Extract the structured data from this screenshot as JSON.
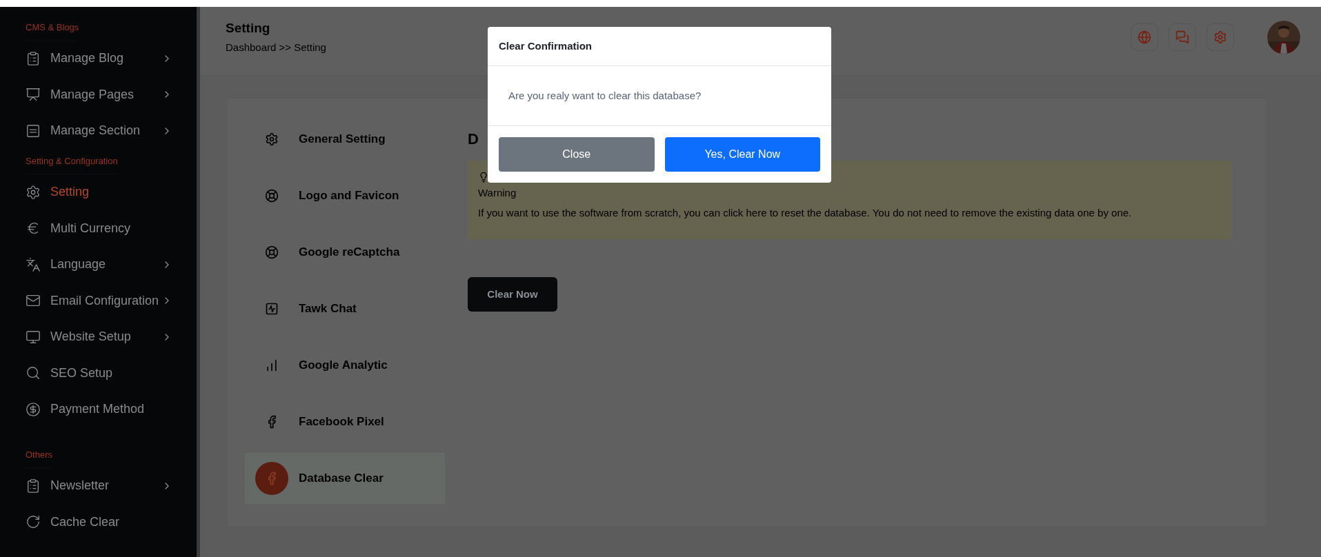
{
  "sidebar": {
    "sections": [
      {
        "title": "CMS & Blogs",
        "items": [
          {
            "label": "Manage Blog",
            "submenu": true,
            "selected": false
          },
          {
            "label": "Manage Pages",
            "submenu": true,
            "selected": false
          },
          {
            "label": "Manage Section",
            "submenu": true,
            "selected": false
          }
        ]
      },
      {
        "title": "Setting & Configuration",
        "items": [
          {
            "label": "Setting",
            "submenu": false,
            "selected": true
          },
          {
            "label": "Multi Currency",
            "submenu": false,
            "selected": false
          },
          {
            "label": "Language",
            "submenu": true,
            "selected": false
          },
          {
            "label": "Email Configuration",
            "submenu": true,
            "selected": false
          },
          {
            "label": "Website Setup",
            "submenu": true,
            "selected": false
          },
          {
            "label": "SEO Setup",
            "submenu": false,
            "selected": false
          },
          {
            "label": "Payment Method",
            "submenu": false,
            "selected": false
          }
        ]
      },
      {
        "title": "Others",
        "items": [
          {
            "label": "Newsletter",
            "submenu": true,
            "selected": false
          },
          {
            "label": "Cache Clear",
            "submenu": false,
            "selected": false
          }
        ]
      }
    ]
  },
  "header": {
    "title": "Setting",
    "breadcrumb": "Dashboard >> Setting"
  },
  "settings_menu": [
    {
      "label": "General Setting",
      "selected": false
    },
    {
      "label": "Logo and Favicon",
      "selected": false
    },
    {
      "label": "Google reCaptcha",
      "selected": false
    },
    {
      "label": "Tawk Chat",
      "selected": false
    },
    {
      "label": "Google Analytic",
      "selected": false
    },
    {
      "label": "Facebook Pixel",
      "selected": false
    },
    {
      "label": "Database Clear",
      "selected": true
    }
  ],
  "content": {
    "heading": "D",
    "warning": {
      "title": "Warning",
      "text": "If you want to use the software from scratch, you can click here to reset the database. You do not need to remove the existing data one by one."
    },
    "button": "Clear Now"
  },
  "modal": {
    "title": "Clear Confirmation",
    "message": "Are you realy want to clear this database?",
    "buttons": [
      {
        "label": "Close",
        "kind": "secondary"
      },
      {
        "label": "Yes, Clear Now",
        "kind": "primary"
      }
    ]
  }
}
